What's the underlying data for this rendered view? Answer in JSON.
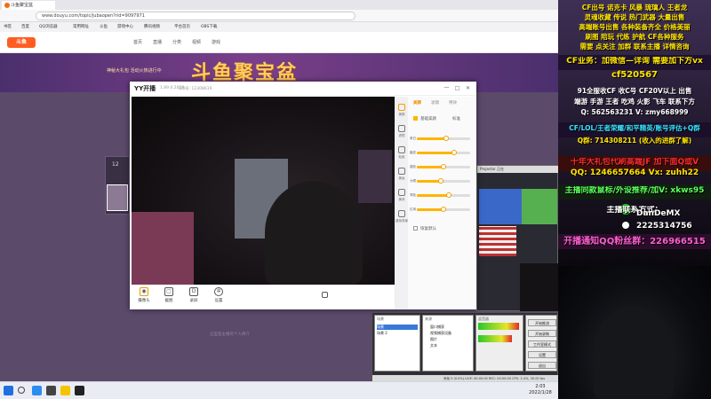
{
  "browser": {
    "tab_title": "斗鱼聚宝盆",
    "address": "www.douyu.com/topic/jubaopen?rid=9097971",
    "bookmarks": [
      "书签",
      "百度",
      "QQ浏览器",
      "常用网址",
      "斗鱼",
      "游戏中心",
      "腾讯视频",
      "平台首页",
      "OBS下载"
    ]
  },
  "site": {
    "logo": "斗鱼",
    "nav": [
      "首页",
      "直播",
      "分类",
      "视频",
      "游戏"
    ],
    "banner_title": "斗鱼聚宝盆",
    "banner_sub": "神秘大礼包 活动火热进行中",
    "card_count": "12",
    "footer_note": "这里是主播的个人简介"
  },
  "yy": {
    "app_name": "YY开播",
    "version": "1.89.0.2059",
    "qq": "QQ号: 12308619",
    "tabs": [
      "美颜",
      "滤镜",
      "特效"
    ],
    "side_labels": [
      "美颜",
      "滤镜",
      "贴纸",
      "美妆",
      "美体",
      "虚拟背景"
    ],
    "beauty_toggle": "基础美颜",
    "beauty_mode": "标准",
    "slider_labels": [
      "美白",
      "磨皮",
      "瘦脸",
      "大眼",
      "窄脸",
      "红润"
    ],
    "slider_levels": [
      0.55,
      0.7,
      0.5,
      0.45,
      0.6,
      0.5
    ],
    "restore_label": "恢复默认",
    "tools": [
      "摄像头",
      "截图",
      "录屏",
      "设置"
    ],
    "window_buttons": [
      "一",
      "□",
      "✕"
    ]
  },
  "obs": {
    "panel_labels": [
      "场景",
      "来源",
      "混音器",
      "控件"
    ],
    "sources": [
      "窗口捕获",
      "视频捕获设备",
      "图片",
      "文本"
    ],
    "scenes": [
      "场景",
      "场景 2"
    ],
    "buttons": [
      "开始推流",
      "开始录制",
      "工作室模式",
      "设置",
      "退出"
    ],
    "status": "丢帧 0 (0.0%)   LIVE: 00:00:00   REC: 00:00:00   CPU: 2.4%, 30.00 fps",
    "mini_title": "Projector 正在"
  },
  "taskbar": {
    "time": "2:03",
    "date": "2022/1/28"
  },
  "overlay": {
    "lines": [
      {
        "text": "CF出号 诺克卡 风暴 琉璃人 王者龙",
        "cls": "ov-sm c-yellow"
      },
      {
        "text": "灵魂收藏 传说 热门武器 大量出售",
        "cls": "ov-sm c-yellow"
      },
      {
        "text": "高端账号出售 各种装备齐全 价格美丽",
        "cls": "ov-sm c-yellow"
      },
      {
        "text": "刷图 陪玩 代练 护航 CF各种服务",
        "cls": "ov-sm c-yellow"
      },
      {
        "text": "需要 点关注 加群 联系主播 详情咨询",
        "cls": "ov-sm c-yellow"
      },
      {
        "text": "CF业务：加微信—详询 需要加下方vx",
        "cls": "ov-md c-yellow"
      },
      {
        "text": "cf520567",
        "cls": "ov-lg c-yellow"
      },
      {
        "text": "91全服收CF 收C号 CF20V以上 出售",
        "cls": "ov-sm c-white"
      },
      {
        "text": "端游 手游 王者 吃鸡 火影 飞车 联系下方",
        "cls": "ov-sm c-white"
      },
      {
        "text": "Q: 562563231  V: zmy668999",
        "cls": "ov-sm c-white"
      },
      {
        "text": "CF/LOL/王者荣耀/和平精英/账号评估+Q群",
        "cls": "ov-sm c-cyan"
      },
      {
        "text": "Q群: 714308211 (收入的进群了解)",
        "cls": "ov-sm c-yellow"
      },
      {
        "text": "十年大礼包代刷高端JF 加下面Q或V",
        "cls": "ov-md c-red"
      },
      {
        "text": "QQ: 1246657664 Vx: zuhh22",
        "cls": "ov-md c-yellow"
      },
      {
        "text": "主播同款鼠标/外设推荐/加V: xkws95",
        "cls": "ov-md c-green"
      },
      {
        "text": "主播联系方式：",
        "cls": "ov-md c-white"
      },
      {
        "text": "DanDeMX",
        "cls": "ov-md c-white"
      },
      {
        "text": "2225314756",
        "cls": "ov-md c-white"
      },
      {
        "text": "开播通知QQ粉丝群：226966515",
        "cls": "ov-lg c-pink"
      }
    ],
    "bands": [
      "#1e1230",
      "#1b0f2b",
      "#3a0d0d",
      "#101f10",
      "#2b0d2b"
    ]
  }
}
